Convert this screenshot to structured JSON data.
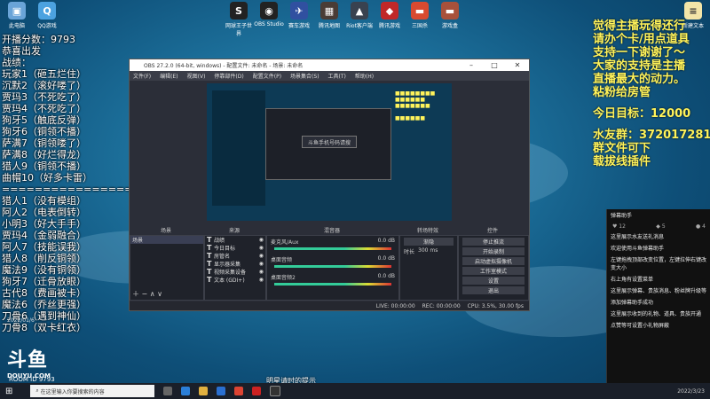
{
  "desktop_icons_top": [
    {
      "label": "此电脑",
      "color": "#6aa4d8",
      "glyph": "▣"
    },
    {
      "label": "QQ游戏",
      "color": "#4ca2e0",
      "glyph": "Q"
    }
  ],
  "desktop_icons_row": [
    {
      "label": "网球王子世界",
      "color": "#222",
      "glyph": "S"
    },
    {
      "label": "OBS Studio",
      "color": "#222",
      "glyph": "◉"
    },
    {
      "label": "赛车游戏",
      "color": "#3050a0",
      "glyph": "✈"
    },
    {
      "label": "腾讯地图",
      "color": "#4a3c35",
      "glyph": "▦"
    },
    {
      "label": "Riot客户端",
      "color": "#39424f",
      "glyph": "▲"
    },
    {
      "label": "腾讯游戏",
      "color": "#c02828",
      "glyph": "◆"
    },
    {
      "label": "三国杀",
      "color": "#d94a30",
      "glyph": "▬"
    },
    {
      "label": "游戏盒",
      "color": "#a8513b",
      "glyph": "▬"
    }
  ],
  "desktop_icon_right": {
    "label": "新建文本",
    "color": "#f3e5a8"
  },
  "left_overlay": {
    "stats": [
      "开播分数：9793",
      "恭喜出发",
      "战绩："
    ],
    "list_a": [
      "玩家1（砸五烂住）",
      "沉默2（滚好喽了）",
      "贾玛3（不死吃了）",
      "贾玛4（不死吃了）",
      "狗牙5（触底反弹）",
      "狗牙6（铜领不播）",
      "萨满7（铜领喽了）",
      "萨满8（好烂得龙）",
      "猎人9（铜领不播）",
      "曲帽10（好多卡雷）"
    ],
    "separator": "=================",
    "list_b": [
      "猎人1（没有模组）",
      "阿人2（电表倒转）",
      "小明3（好大手手）",
      "贾玛4（金弱融合）",
      "阿人7（技能误我）",
      "猎人8（削反铜领）",
      "魔法9（没有铜领）",
      "狗牙7（迁骨放眼）",
      "古代8（费画被卡）",
      "魔法6（乔丝更强）",
      "刀骨6（遇到神仙）",
      "刀骨8（双卡红衣）"
    ]
  },
  "right_overlay": [
    "觉得主播玩得还行",
    "请办个卡/用点道具",
    "支持一下谢谢了～",
    "大家的支持是主播",
    "直播最大的动力。",
    "粘粉给房管",
    "",
    "今日目标：12000",
    "",
    "水友群：372017281",
    "群文件可下",
    "载拔线插件"
  ],
  "obs": {
    "title": "OBS 27.2.0 (64-bit, windows) - 配置文件: 未命名 - 场景: 未命名",
    "menu": [
      "文件(F)",
      "编辑(E)",
      "视图(V)",
      "停靠部件(D)",
      "配置文件(P)",
      "场景集合(S)",
      "工具(T)",
      "帮助(H)"
    ],
    "preview_caption": "斗鱼手机号码请搜",
    "docks": {
      "scenes": "场景",
      "sources": "来源",
      "mixer": "混音器",
      "transitions": "转场特效",
      "controls": "控件"
    },
    "scene_items": [
      "场景"
    ],
    "source_items": [
      "战绩",
      "今日目标",
      "房管名",
      "显示器采集",
      "视频采集设备",
      "文本 (GDI+)"
    ],
    "mixer_channels": [
      {
        "name": "麦克风/Aux",
        "db": "0.0 dB"
      },
      {
        "name": "桌面音频",
        "db": "0.0 dB"
      },
      {
        "name": "桌面音频2",
        "db": "0.0 dB"
      }
    ],
    "transition": {
      "type": "渐隐",
      "duration_label": "时长",
      "duration": "300 ms"
    },
    "control_buttons": [
      "停止推流",
      "开始录制",
      "启动虚拟摄像机",
      "工作室模式",
      "设置",
      "退出"
    ],
    "status": [
      "LIVE: 00:00:00",
      "REC: 00:00:00",
      "CPU: 3.5%, 30.00 fps"
    ]
  },
  "chat": {
    "header": "弹幕助手",
    "counts": [
      "12",
      "5",
      "4"
    ],
    "msgs": [
      "这里展示水友送礼消息",
      "欢迎使用斗鱼弹幕助手",
      "左键拖拽顶部改变位置，左键拉伸右键改变大小",
      "右上角有设置菜单",
      "这里展示弹幕、贵族消息、粉丝牌升级等",
      "添加弹幕助手成功",
      "这里展示收到的礼物、道具、贵族开通",
      "点赞等可设置小礼物屏蔽"
    ]
  },
  "logo": {
    "main": "斗鱼",
    "sub": "DOUYU.COM",
    "date": "2022/01/6"
  },
  "bottom_left": "ROOM ID 9793",
  "taskbar": {
    "search_placeholder": "在这里输入你要搜索的内容",
    "time": "2022/3/23"
  },
  "subtitle": "明星请时的提示"
}
